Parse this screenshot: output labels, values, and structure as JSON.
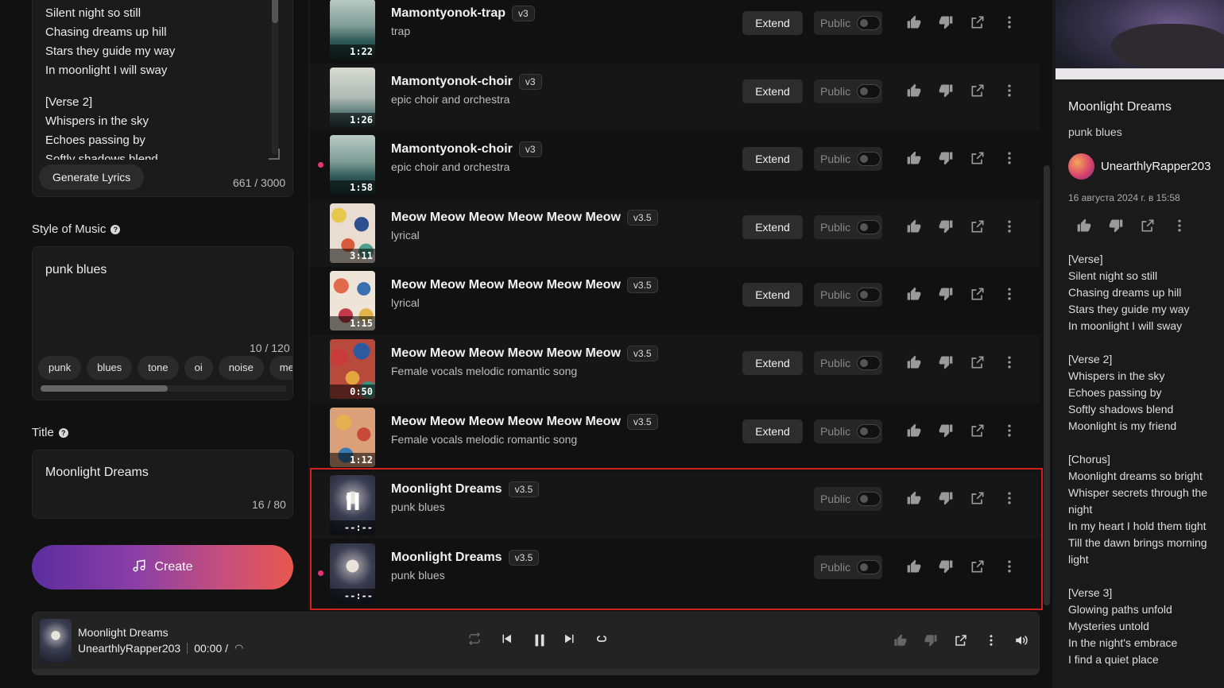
{
  "lyrics_editor": {
    "lines": [
      "Silent night so still",
      "Chasing dreams up hill",
      "Stars they guide my way",
      "In moonlight I will sway",
      "",
      "[Verse 2]",
      "Whispers in the sky",
      "Echoes passing by",
      "Softly shadows blend"
    ],
    "generate_label": "Generate Lyrics",
    "counter": "661 / 3000"
  },
  "style": {
    "label": "Style of Music",
    "value": "punk blues",
    "counter": "10 / 120",
    "tags": [
      "punk",
      "blues",
      "tone",
      "oi",
      "noise",
      "merse"
    ]
  },
  "title_field": {
    "label": "Title",
    "value": "Moonlight Dreams",
    "counter": "16 / 80"
  },
  "create_label": "Create",
  "songs": [
    {
      "title": "Mamontyonok-trap",
      "version": "v3",
      "style": "trap",
      "duration": "1:22",
      "art": "sea",
      "extend": "Extend",
      "public": "Public",
      "dot": false
    },
    {
      "title": "Mamontyonok-choir",
      "version": "v3",
      "style": "epic choir and orchestra",
      "duration": "1:26",
      "art": "ship",
      "extend": "Extend",
      "public": "Public",
      "dot": false
    },
    {
      "title": "Mamontyonok-choir",
      "version": "v3",
      "style": "epic choir and orchestra",
      "duration": "1:58",
      "art": "sea",
      "extend": "Extend",
      "public": "Public",
      "dot": true
    },
    {
      "title": "Meow Meow Meow Meow Meow Meow",
      "version": "v3.5",
      "style": "lyrical",
      "duration": "3:11",
      "art": "cats1",
      "extend": "Extend",
      "public": "Public",
      "dot": false
    },
    {
      "title": "Meow Meow Meow Meow Meow Meow",
      "version": "v3.5",
      "style": "lyrical",
      "duration": "1:15",
      "art": "cats2",
      "extend": "Extend",
      "public": "Public",
      "dot": false
    },
    {
      "title": "Meow Meow Meow Meow Meow Meow",
      "version": "v3.5",
      "style": "Female vocals melodic romantic song",
      "duration": "0:50",
      "art": "cats3",
      "extend": "Extend",
      "public": "Public",
      "dot": false
    },
    {
      "title": "Meow Meow Meow Meow Meow Meow",
      "version": "v3.5",
      "style": "Female vocals melodic romantic song",
      "duration": "1:12",
      "art": "cats4",
      "extend": "Extend",
      "public": "Public",
      "dot": false
    },
    {
      "title": "Moonlight Dreams",
      "version": "v3.5",
      "style": "punk blues",
      "duration": "--:--",
      "art": "moon",
      "extend": "",
      "public": "Public",
      "dot": false,
      "playing": true
    },
    {
      "title": "Moonlight Dreams",
      "version": "v3.5",
      "style": "punk blues",
      "duration": "--:--",
      "art": "moon",
      "extend": "",
      "public": "Public",
      "dot": true
    }
  ],
  "detail": {
    "title": "Moonlight Dreams",
    "style": "punk blues",
    "user": "UnearthlyRapper203",
    "date": "16 августа 2024 г. в 15:58",
    "lyrics": [
      "[Verse]",
      "Silent night so still",
      "Chasing dreams up hill",
      "Stars they guide my way",
      "In moonlight I will sway",
      "",
      "[Verse 2]",
      "Whispers in the sky",
      "Echoes passing by",
      "Softly shadows blend",
      "Moonlight is my friend",
      "",
      "[Chorus]",
      "Moonlight dreams so bright",
      "Whisper secrets through the night",
      "In my heart I hold them tight",
      "Till the dawn brings morning light",
      "",
      "[Verse 3]",
      "Glowing paths unfold",
      "Mysteries untold",
      "In the night's embrace",
      "I find a quiet place"
    ]
  },
  "player": {
    "title": "Moonlight Dreams",
    "user": "UnearthlyRapper203",
    "time": "00:00 /"
  },
  "colors": {
    "accent_dot": "#e5357a",
    "highlight_border": "#d21f1f",
    "create_gradient_start": "#5b2d9e",
    "create_gradient_end": "#e8574e"
  }
}
